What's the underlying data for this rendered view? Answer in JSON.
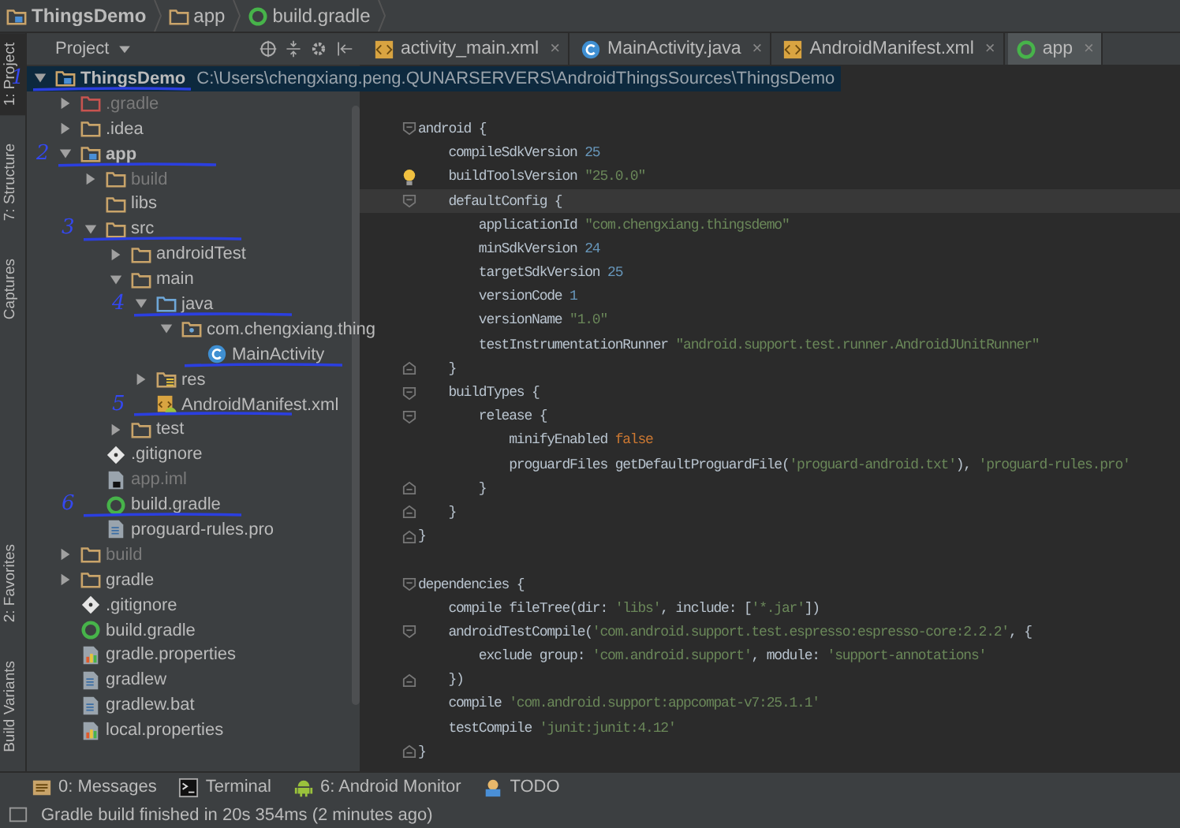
{
  "breadcrumb": [
    {
      "label": "ThingsDemo",
      "kind": "module"
    },
    {
      "label": "app",
      "kind": "folder"
    },
    {
      "label": "build.gradle",
      "kind": "gradle"
    }
  ],
  "tool_strip_top": [
    {
      "label": "1: Project",
      "selected": true
    },
    {
      "label": "7: Structure",
      "selected": false
    },
    {
      "label": "Captures",
      "selected": false
    }
  ],
  "tool_strip_bottom": [
    {
      "label": "2: Favorites",
      "selected": false
    },
    {
      "label": "Build Variants",
      "selected": false
    }
  ],
  "project_panel": {
    "title": "Project"
  },
  "tree": [
    {
      "label": "ThingsDemo",
      "path": "C:\\Users\\chengxiang.peng.QUNARSERVERS\\AndroidThingsSources\\ThingsDemo",
      "kind": "module",
      "expanded": true,
      "selected": true,
      "excluded": false,
      "annotation": "1",
      "children": [
        {
          "label": ".gradle",
          "kind": "excluded_folder",
          "expanded": false,
          "selected": false,
          "excluded": true
        },
        {
          "label": ".idea",
          "kind": "folder",
          "expanded": false,
          "selected": false,
          "excluded": false
        },
        {
          "label": "app",
          "kind": "module",
          "expanded": true,
          "selected": false,
          "excluded": false,
          "bold": true,
          "annotation": "2",
          "children": [
            {
              "label": "build",
              "kind": "folder",
              "expanded": false,
              "selected": false,
              "excluded": true
            },
            {
              "label": "libs",
              "kind": "folder",
              "selected": false,
              "excluded": false
            },
            {
              "label": "src",
              "kind": "folder",
              "expanded": true,
              "selected": false,
              "excluded": false,
              "annotation": "3",
              "children": [
                {
                  "label": "androidTest",
                  "kind": "folder",
                  "expanded": false,
                  "selected": false,
                  "excluded": false
                },
                {
                  "label": "main",
                  "kind": "folder",
                  "expanded": true,
                  "selected": false,
                  "excluded": false,
                  "children": [
                    {
                      "label": "java",
                      "kind": "java_folder",
                      "expanded": true,
                      "selected": false,
                      "excluded": false,
                      "annotation": "4",
                      "children": [
                        {
                          "label": "com.chengxiang.thing",
                          "kind": "package",
                          "expanded": true,
                          "selected": false,
                          "excluded": false,
                          "children": [
                            {
                              "label": "MainActivity",
                              "kind": "class",
                              "selected": false,
                              "excluded": false,
                              "underline": true
                            }
                          ]
                        }
                      ]
                    },
                    {
                      "label": "res",
                      "kind": "res_folder",
                      "expanded": false,
                      "selected": false,
                      "excluded": false
                    },
                    {
                      "label": "AndroidManifest.xml",
                      "kind": "manifest",
                      "selected": false,
                      "excluded": false,
                      "annotation": "5"
                    }
                  ]
                },
                {
                  "label": "test",
                  "kind": "folder",
                  "expanded": false,
                  "selected": false,
                  "excluded": false
                }
              ]
            },
            {
              "label": ".gitignore",
              "kind": "gitignore",
              "selected": false,
              "excluded": false
            },
            {
              "label": "app.iml",
              "kind": "iml",
              "selected": false,
              "excluded": true
            },
            {
              "label": "build.gradle",
              "kind": "gradle",
              "selected": false,
              "excluded": false,
              "annotation": "6"
            },
            {
              "label": "proguard-rules.pro",
              "kind": "text_file",
              "selected": false,
              "excluded": false
            }
          ]
        },
        {
          "label": "build",
          "kind": "folder",
          "expanded": false,
          "selected": false,
          "excluded": true
        },
        {
          "label": "gradle",
          "kind": "folder",
          "expanded": false,
          "selected": false,
          "excluded": false
        },
        {
          "label": ".gitignore",
          "kind": "gitignore",
          "selected": false,
          "excluded": false
        },
        {
          "label": "build.gradle",
          "kind": "gradle",
          "selected": false,
          "excluded": false
        },
        {
          "label": "gradle.properties",
          "kind": "properties",
          "selected": false,
          "excluded": false
        },
        {
          "label": "gradlew",
          "kind": "text_file",
          "selected": false,
          "excluded": false
        },
        {
          "label": "gradlew.bat",
          "kind": "text_file",
          "selected": false,
          "excluded": false
        },
        {
          "label": "local.properties",
          "kind": "properties",
          "selected": false,
          "excluded": false
        }
      ]
    }
  ],
  "editor_tabs": [
    {
      "label": "activity_main.xml",
      "kind": "xml",
      "selected": false,
      "close": "×"
    },
    {
      "label": "MainActivity.java",
      "kind": "class",
      "selected": false,
      "close": "×"
    },
    {
      "label": "AndroidManifest.xml",
      "kind": "xml",
      "selected": false,
      "close": "×"
    },
    {
      "label": "app",
      "kind": "gradle",
      "selected": true,
      "close": "×"
    }
  ],
  "code": [
    {
      "kind": "blank"
    },
    {
      "kind": "blank"
    },
    {
      "kind": "fold_start",
      "tokens": [
        {
          "t": "android {",
          "kind": "plain"
        }
      ]
    },
    {
      "kind": "plain",
      "tokens": [
        {
          "t": "    compileSdkVersion ",
          "kind": "plain"
        },
        {
          "t": "25",
          "kind": "num"
        }
      ]
    },
    {
      "kind": "plain",
      "bulb": true,
      "tokens": [
        {
          "t": "    buildToolsVersion ",
          "kind": "plain"
        },
        {
          "t": "\"25.0.0\"",
          "kind": "str"
        }
      ]
    },
    {
      "kind": "fold_start",
      "current": true,
      "tokens": [
        {
          "t": "    defaultConfig {",
          "kind": "plain"
        }
      ]
    },
    {
      "kind": "plain",
      "tokens": [
        {
          "t": "        applicationId ",
          "kind": "plain"
        },
        {
          "t": "\"com.chengxiang.thingsdemo\"",
          "kind": "str"
        }
      ]
    },
    {
      "kind": "plain",
      "tokens": [
        {
          "t": "        minSdkVersion ",
          "kind": "plain"
        },
        {
          "t": "24",
          "kind": "num"
        }
      ]
    },
    {
      "kind": "plain",
      "tokens": [
        {
          "t": "        targetSdkVersion ",
          "kind": "plain"
        },
        {
          "t": "25",
          "kind": "num"
        }
      ]
    },
    {
      "kind": "plain",
      "tokens": [
        {
          "t": "        versionCode ",
          "kind": "plain"
        },
        {
          "t": "1",
          "kind": "num"
        }
      ]
    },
    {
      "kind": "plain",
      "tokens": [
        {
          "t": "        versionName ",
          "kind": "plain"
        },
        {
          "t": "\"1.0\"",
          "kind": "str"
        }
      ]
    },
    {
      "kind": "plain",
      "tokens": [
        {
          "t": "        testInstrumentationRunner ",
          "kind": "plain"
        },
        {
          "t": "\"android.support.test.runner.AndroidJUnitRunner\"",
          "kind": "str"
        }
      ]
    },
    {
      "kind": "fold_end",
      "tokens": [
        {
          "t": "    }",
          "kind": "plain"
        }
      ]
    },
    {
      "kind": "fold_start",
      "tokens": [
        {
          "t": "    buildTypes {",
          "kind": "plain"
        }
      ]
    },
    {
      "kind": "fold_start",
      "tokens": [
        {
          "t": "        release {",
          "kind": "plain"
        }
      ]
    },
    {
      "kind": "plain",
      "tokens": [
        {
          "t": "            minifyEnabled ",
          "kind": "plain"
        },
        {
          "t": "false",
          "kind": "kw"
        }
      ]
    },
    {
      "kind": "plain",
      "tokens": [
        {
          "t": "            proguardFiles getDefaultProguardFile(",
          "kind": "plain"
        },
        {
          "t": "'proguard-android.txt'",
          "kind": "str"
        },
        {
          "t": "), ",
          "kind": "plain"
        },
        {
          "t": "'proguard-rules.pro'",
          "kind": "str"
        }
      ]
    },
    {
      "kind": "fold_end",
      "tokens": [
        {
          "t": "        }",
          "kind": "plain"
        }
      ]
    },
    {
      "kind": "fold_end",
      "tokens": [
        {
          "t": "    }",
          "kind": "plain"
        }
      ]
    },
    {
      "kind": "fold_end",
      "tokens": [
        {
          "t": "}",
          "kind": "plain"
        }
      ]
    },
    {
      "kind": "blank"
    },
    {
      "kind": "fold_start",
      "tokens": [
        {
          "t": "dependencies {",
          "kind": "plain"
        }
      ]
    },
    {
      "kind": "plain",
      "tokens": [
        {
          "t": "    compile fileTree(dir: ",
          "kind": "plain"
        },
        {
          "t": "'libs'",
          "kind": "str"
        },
        {
          "t": ", include: [",
          "kind": "plain"
        },
        {
          "t": "'*.jar'",
          "kind": "str"
        },
        {
          "t": "])",
          "kind": "plain"
        }
      ]
    },
    {
      "kind": "fold_start",
      "tokens": [
        {
          "t": "    androidTestCompile(",
          "kind": "plain"
        },
        {
          "t": "'com.android.support.test.espresso:espresso-core:2.2.2'",
          "kind": "str"
        },
        {
          "t": ", {",
          "kind": "plain"
        }
      ]
    },
    {
      "kind": "plain",
      "tokens": [
        {
          "t": "        exclude group: ",
          "kind": "plain"
        },
        {
          "t": "'com.android.support'",
          "kind": "str"
        },
        {
          "t": ", module: ",
          "kind": "plain"
        },
        {
          "t": "'support-annotations'",
          "kind": "str"
        }
      ]
    },
    {
      "kind": "fold_end",
      "tokens": [
        {
          "t": "    })",
          "kind": "plain"
        }
      ]
    },
    {
      "kind": "plain",
      "tokens": [
        {
          "t": "    compile ",
          "kind": "plain"
        },
        {
          "t": "'com.android.support:appcompat-v7:25.1.1'",
          "kind": "str"
        }
      ]
    },
    {
      "kind": "plain",
      "tokens": [
        {
          "t": "    testCompile ",
          "kind": "plain"
        },
        {
          "t": "'junit:junit:4.12'",
          "kind": "str"
        }
      ]
    },
    {
      "kind": "fold_end",
      "tokens": [
        {
          "t": "}",
          "kind": "plain"
        }
      ]
    }
  ],
  "bottom_tools": [
    {
      "label": "0: Messages",
      "kind": "messages"
    },
    {
      "label": "Terminal",
      "kind": "terminal"
    },
    {
      "label": "6: Android Monitor",
      "kind": "android"
    },
    {
      "label": "TODO",
      "kind": "todo"
    }
  ],
  "status_bar": {
    "message": "Gradle build finished in 20s 354ms (2 minutes ago)"
  }
}
